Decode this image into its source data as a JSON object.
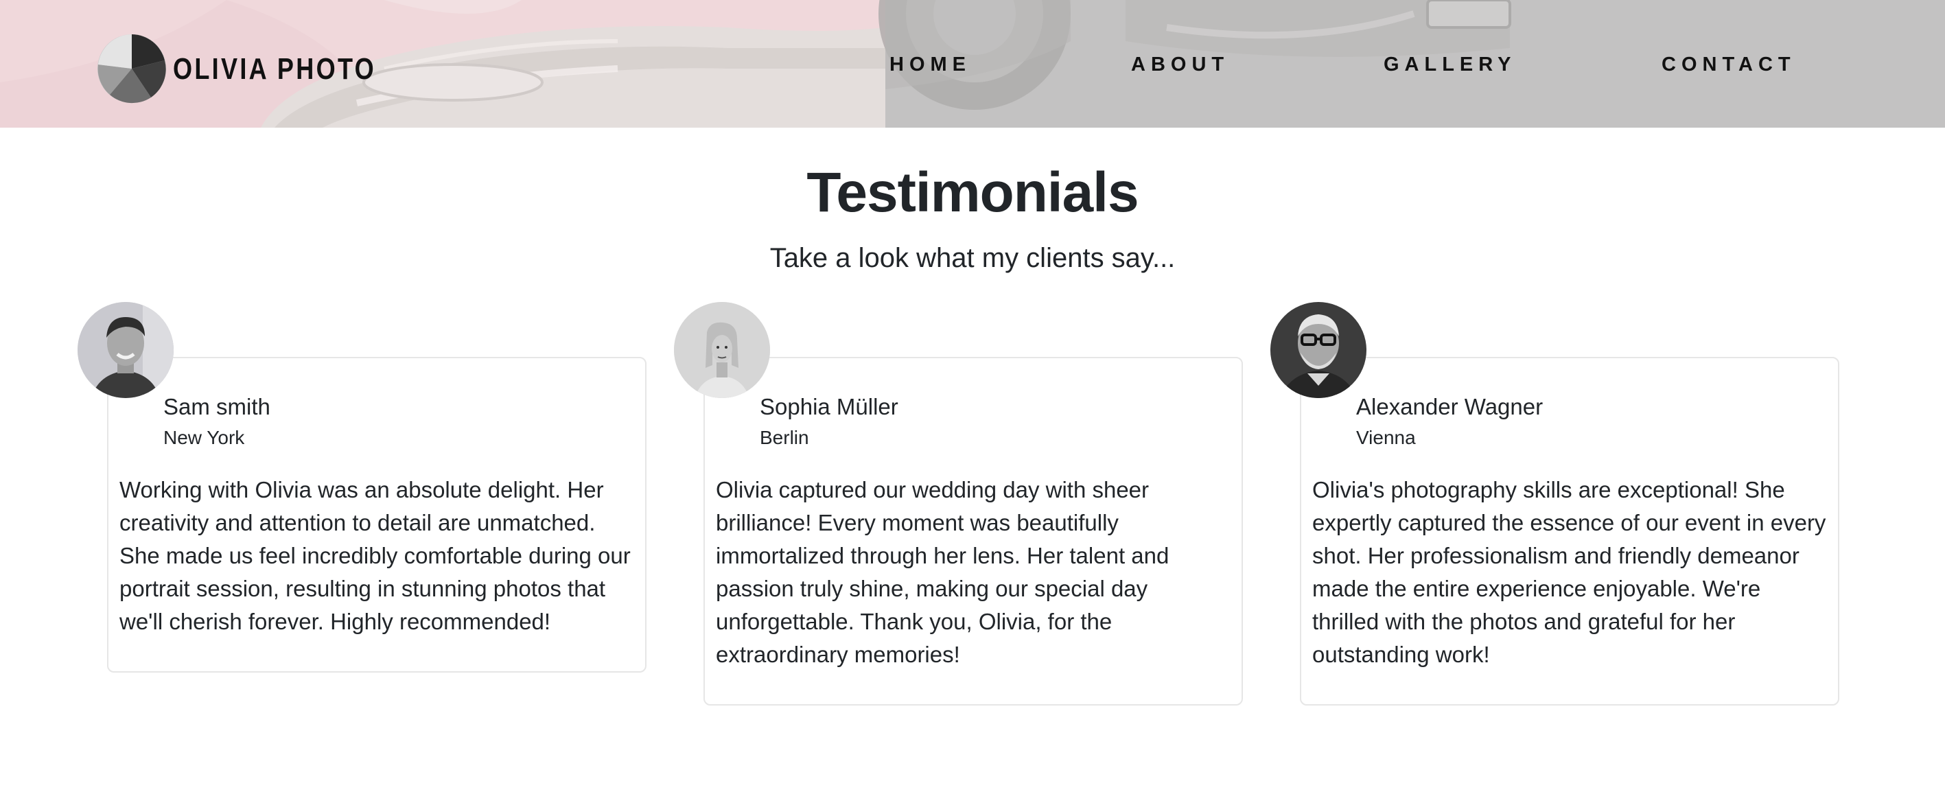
{
  "brand": {
    "name": "OLIVIA PHOTO"
  },
  "nav": [
    {
      "label": "HOME"
    },
    {
      "label": "ABOUT"
    },
    {
      "label": "GALLERY"
    },
    {
      "label": "CONTACT"
    }
  ],
  "section": {
    "title": "Testimonials",
    "subtitle": "Take a look what my clients say..."
  },
  "testimonials": [
    {
      "name": "Sam smith",
      "city": "New York",
      "quote": "Working with Olivia was an absolute delight. Her creativity and attention to detail are unmatched. She made us feel incredibly comfortable during our portrait session, resulting in stunning photos that we'll cherish forever. Highly recommended!"
    },
    {
      "name": "Sophia Müller",
      "city": "Berlin",
      "quote": "Olivia captured our wedding day with sheer brilliance! Every moment was beautifully immortalized through her lens. Her talent and passion truly shine, making our special day unforgettable. Thank you, Olivia, for the extraordinary memories!"
    },
    {
      "name": "Alexander Wagner",
      "city": "Vienna",
      "quote": "Olivia's photography skills are exceptional! She expertly captured the essence of our event in every shot. Her professionalism and friendly demeanor made the entire experience enjoyable. We're thrilled with the photos and grateful for her outstanding work!"
    }
  ],
  "colors": {
    "text": "#212529",
    "card_border": "#e6e6e6",
    "nav_text": "#111111"
  },
  "icons": {
    "logo": "camera-aperture-logo-icon"
  }
}
